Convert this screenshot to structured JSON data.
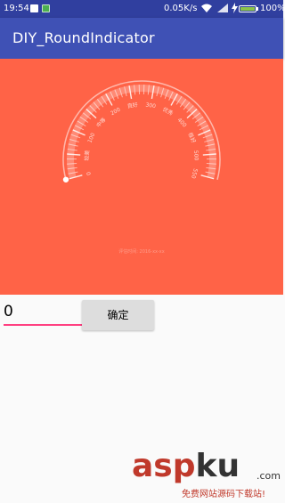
{
  "status_bar": {
    "time": "19:54",
    "net_speed": "0.05K/s",
    "battery": "100%",
    "battery_level": 1.0
  },
  "app_bar": {
    "title": "DIY_RoundIndicator"
  },
  "gauge": {
    "background_color": "#ff6347",
    "min": 0,
    "max": 550,
    "current_value": 0,
    "tick_labels": [
      {
        "value": 0,
        "label": "0"
      },
      {
        "value": 50,
        "label": "较差"
      },
      {
        "value": 100,
        "label": "100"
      },
      {
        "value": 150,
        "label": "中等"
      },
      {
        "value": 200,
        "label": "200"
      },
      {
        "value": 250,
        "label": "良好"
      },
      {
        "value": 300,
        "label": "300"
      },
      {
        "value": 350,
        "label": "优秀"
      },
      {
        "value": 400,
        "label": "400"
      },
      {
        "value": 450,
        "label": "极好"
      },
      {
        "value": 500,
        "label": "500"
      }
    ],
    "end_label": "550",
    "footer_text": "评估时间: 2016-xx-xx"
  },
  "input": {
    "value": "0"
  },
  "confirm_button": {
    "label": "确定"
  },
  "watermark": {
    "main_parts": [
      "asp",
      "ku"
    ],
    "main_colors": [
      "#c0392b",
      "#333333"
    ],
    "dot_com": ".com",
    "subtitle": "免费网站源码下载站!"
  }
}
